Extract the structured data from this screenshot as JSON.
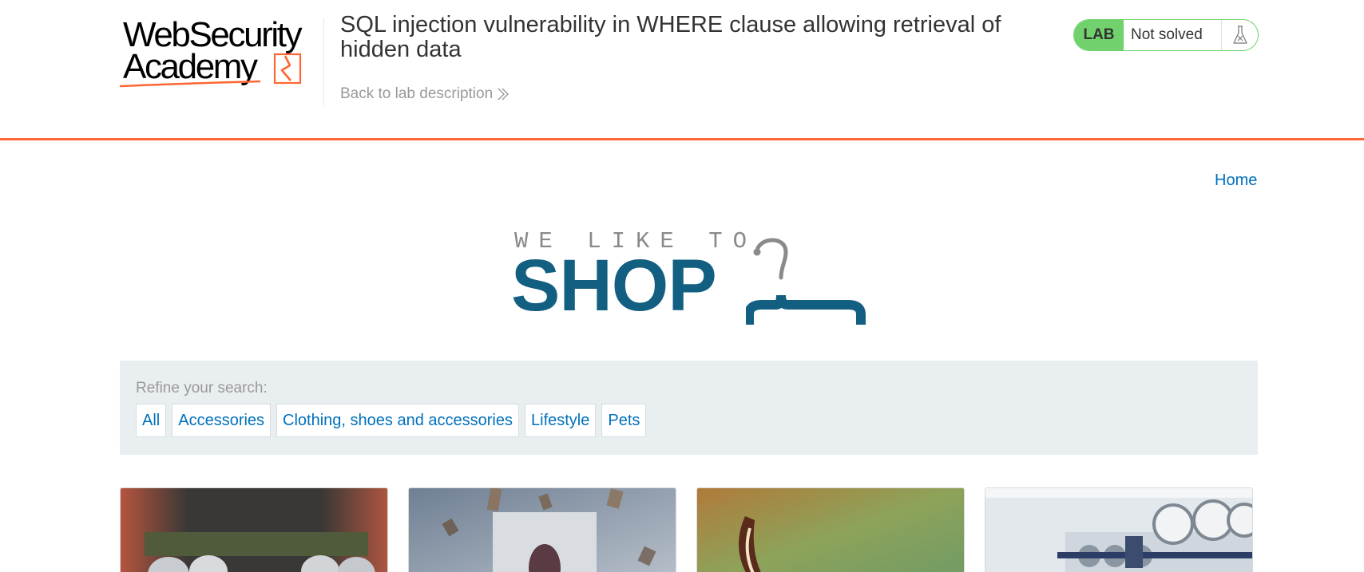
{
  "academy": {
    "logo_line1": "WebSecurity",
    "logo_line2": "Academy",
    "lab_title": "SQL injection vulnerability in WHERE clause allowing retrieval of hidden data",
    "back_link": "Back to lab description",
    "lab_badge": "LAB",
    "lab_status": "Not solved",
    "accent_color": "#ff6633",
    "status_color": "#70d16d"
  },
  "nav": {
    "home": "Home"
  },
  "shop_logo": {
    "tagline": "WE LIKE TO",
    "word": "SHOP",
    "brand_color": "#135f81"
  },
  "filters": {
    "label": "Refine your search:",
    "categories": [
      "All",
      "Accessories",
      "Clothing, shoes and accessories",
      "Lifestyle",
      "Pets"
    ]
  },
  "products": [
    {
      "image": "beer-belt-photo"
    },
    {
      "image": "flying-books-photo"
    },
    {
      "image": "fur-eyebrow-photo"
    },
    {
      "image": "laundromat-photo"
    }
  ]
}
